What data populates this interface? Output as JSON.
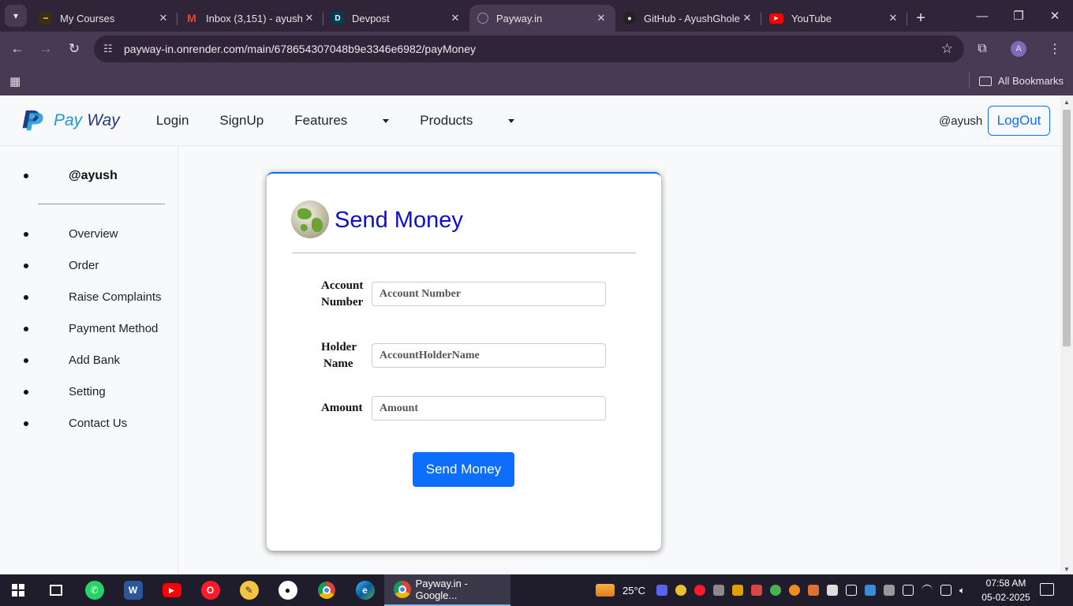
{
  "browser": {
    "tabs": [
      {
        "label": "My Courses",
        "favicon": "courses-icon"
      },
      {
        "label": "Inbox (3,151) - ayush",
        "favicon": "gmail-icon"
      },
      {
        "label": "Devpost",
        "favicon": "devpost-icon"
      },
      {
        "label": "Payway.in",
        "favicon": "globe-icon",
        "active": true
      },
      {
        "label": "GitHub - AyushGhole",
        "favicon": "github-icon"
      },
      {
        "label": "YouTube",
        "favicon": "youtube-icon"
      }
    ],
    "url": "payway-in.onrender.com/main/678654307048b9e3346e6982/payMoney",
    "profile_initial": "A",
    "all_bookmarks": "All Bookmarks"
  },
  "navbar": {
    "brand_pay": "Pay",
    "brand_way": "Way",
    "links": {
      "login": "Login",
      "signup": "SignUp",
      "features": "Features",
      "products": "Products"
    },
    "user": "@ayush",
    "logout": "LogOut"
  },
  "sidebar": {
    "user": "@ayush",
    "items": [
      "Overview",
      "Order",
      "Raise Complaints",
      "Payment Method",
      "Add Bank",
      "Setting",
      "Contact Us"
    ]
  },
  "form": {
    "title": "Send Money",
    "account_label_1": "Account",
    "account_label_2": "Number",
    "account_placeholder": "Account Number",
    "holder_label_1": "Holder",
    "holder_label_2": "Name",
    "holder_placeholder": "AccountHolderName",
    "amount_label": "Amount",
    "amount_placeholder": "Amount",
    "submit": "Send Money"
  },
  "taskbar": {
    "active_window": "Payway.in - Google...",
    "temperature": "25°C",
    "time": "07:58 AM",
    "date": "05-02-2025"
  },
  "colors": {
    "accent": "#0d6efd",
    "title": "#0d0dd1",
    "chrome_bg": "#2f2438"
  }
}
